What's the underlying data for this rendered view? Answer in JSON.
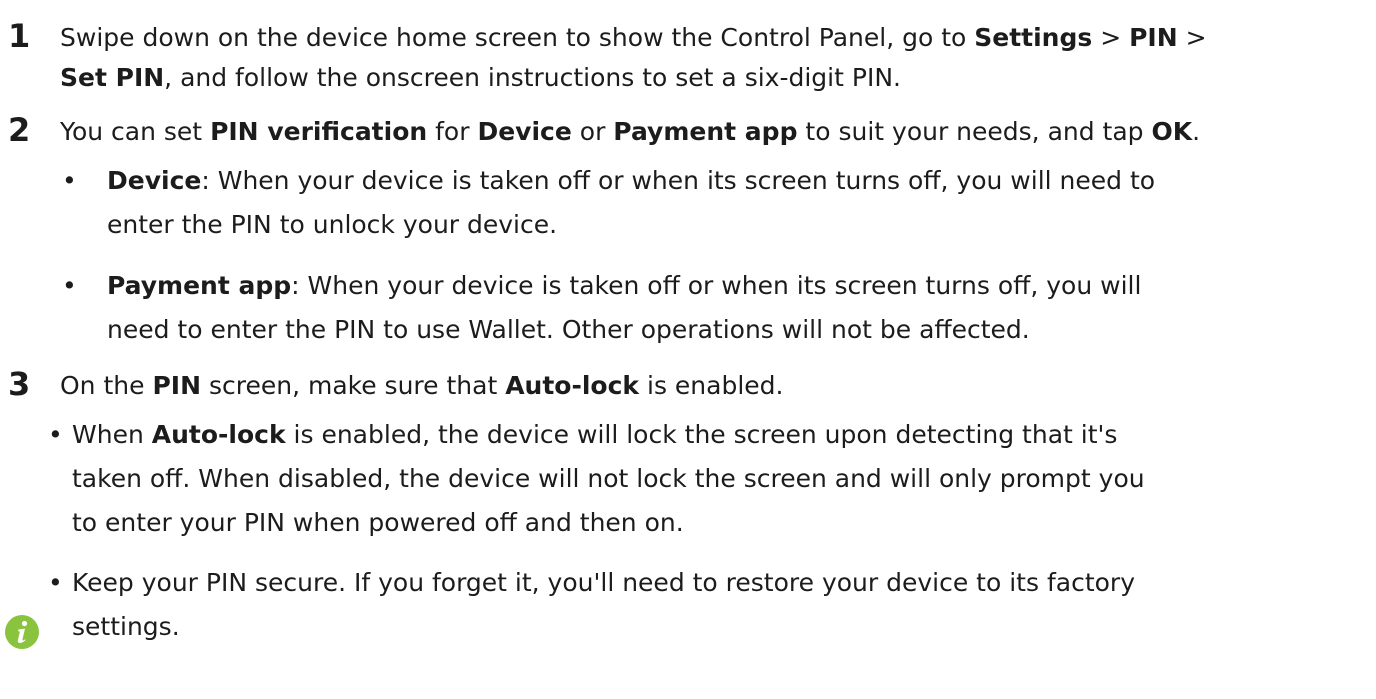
{
  "step1": {
    "number": "1",
    "line1": {
      "t1": "Swipe down on the device home screen to show the Control Panel, go to ",
      "b1": "Settings",
      "t2": " > ",
      "b2": "PIN",
      "t3": " >"
    },
    "line2": {
      "b1": "Set PIN",
      "t1": ", and follow the onscreen instructions to set a six-digit PIN."
    }
  },
  "step2": {
    "number": "2",
    "line1": {
      "t1": "You can set ",
      "b1": "PIN verification",
      "t2": " for ",
      "b2": "Device",
      "t3": " or ",
      "b3": "Payment app",
      "t4": " to suit your needs, and tap ",
      "b4": "OK",
      "t5": "."
    },
    "bullets": [
      {
        "bullet": "•",
        "line1_bold": "Device",
        "line1_text": ": When your device is taken off or when its screen turns off, you will need to",
        "line2_text": "enter the PIN to unlock your device."
      },
      {
        "bullet": "•",
        "line1_bold": "Payment app",
        "line1_text": ": When your device is taken off or when its screen turns off, you will",
        "line2_text": "need to enter the PIN to use Wallet. Other operations will not be affected."
      }
    ]
  },
  "step3": {
    "number": "3",
    "line1": {
      "t1": "On the ",
      "b1": "PIN",
      "t2": " screen, make sure that ",
      "b2": "Auto-lock",
      "t3": " is enabled."
    }
  },
  "note": {
    "icon": "info-icon",
    "icon_color": "#8ac43f",
    "bullets": [
      {
        "bullet": "•",
        "line1_text_a": "When ",
        "line1_bold": "Auto-lock",
        "line1_text_b": " is enabled, the device will lock the screen upon detecting that it's",
        "line2_text": "taken off. When disabled, the device will not lock the screen and will only prompt you",
        "line3_text": "to enter your PIN when powered off and then on."
      },
      {
        "bullet": "•",
        "line1_text": "Keep your PIN secure. If you forget it, you'll need to restore your device to its factory",
        "line2_text": "settings."
      }
    ]
  }
}
